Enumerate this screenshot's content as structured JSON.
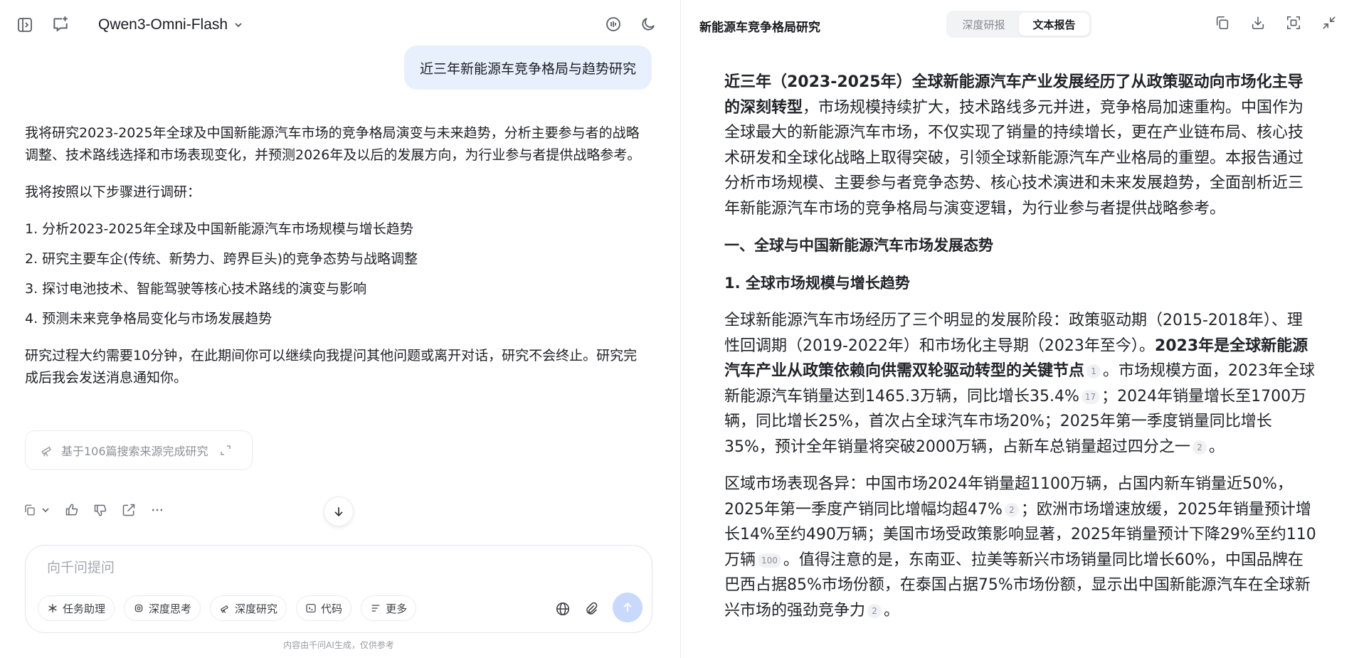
{
  "left": {
    "model_name": "Qwen3-Omni-Flash",
    "user_message": "近三年新能源车竞争格局与趋势研究",
    "answer": {
      "intro": "我将研究2023-2025年全球及中国新能源汽车市场的竞争格局演变与未来趋势，分析主要参与者的战略调整、技术路线选择和市场表现变化，并预测2026年及以后的发展方向，为行业参与者提供战略参考。",
      "steps_intro": "我将按照以下步骤进行调研：",
      "steps": [
        "1. 分析2023-2025年全球及中国新能源汽车市场规模与增长趋势",
        "2. 研究主要车企(传统、新势力、跨界巨头)的竞争态势与战略调整",
        "3. 探讨电池技术、智能驾驶等核心技术路线的演变与影响",
        "4. 预测未来竞争格局变化与市场发展趋势"
      ],
      "closing": "研究过程大约需要10分钟，在此期间你可以继续向我提问其他问题或离开对话，研究不会终止。研究完成后我会发送消息通知你。"
    },
    "source_card": "基于106篇搜索来源完成研究",
    "composer": {
      "placeholder": "向千问提问",
      "chips": [
        "任务助理",
        "深度思考",
        "深度研究",
        "代码",
        "更多"
      ]
    },
    "disclaimer": "内容由千问AI生成，仅供参考"
  },
  "right": {
    "title": "新能源车竞争格局研究",
    "tabs": [
      "深度研报",
      "文本报告"
    ],
    "active_tab": "文本报告",
    "report": {
      "p1_bold": "近三年（2023-2025年）全球新能源汽车产业发展经历了从政策驱动向市场化主导的深刻转型",
      "p1_rest": "，市场规模持续扩大，技术路线多元并进，竞争格局加速重构。中国作为全球最大的新能源汽车市场，不仅实现了销量的持续增长，更在产业链布局、核心技术研发和全球化战略上取得突破，引领全球新能源汽车产业格局的重塑。本报告通过分析市场规模、主要参与者竞争态势、核心技术演进和未来发展趋势，全面剖析近三年新能源汽车市场的竞争格局与演变逻辑，为行业参与者提供战略参考。",
      "h2": "一、全球与中国新能源汽车市场发展态势",
      "h3": "1. 全球市场规模与增长趋势",
      "p2_a": "全球新能源汽车市场经历了三个明显的发展阶段：政策驱动期（2015-2018年）、理性回调期（2019-2022年）和市场化主导期（2023年至今）。",
      "p2_bold": "2023年是全球新能源汽车产业从政策依赖向供需双轮驱动转型的关键节点",
      "cite1": "1",
      "p2_b": "。市场规模方面，2023年全球新能源汽车销量达到1465.3万辆，同比增长35.4%",
      "cite2": "17",
      "p2_c": "；2024年销量增长至1700万辆，同比增长25%，首次占全球汽车市场20%；2025年第一季度销量同比增长35%，预计全年销量将突破2000万辆，占新车总销量超过四分之一",
      "cite3": "2",
      "p2_d": "。",
      "p3_a": "区域市场表现各异：中国市场2024年销量超1100万辆，占国内新车销量近50%，2025年第一季度产销同比增幅均超47%",
      "cite4": "2",
      "p3_b": "；欧洲市场增速放缓，2025年销量预计增长14%至约490万辆；美国市场受政策影响显著，2025年销量预计下降29%至约110万辆",
      "cite5": "100",
      "p3_c": "。值得注意的是，东南亚、拉美等新兴市场销量同比增长60%，中国品牌在巴西占据85%市场份额，在泰国占据75%市场份额，显示出中国新能源汽车在全球新兴市场的强劲竞争力",
      "cite6": "2",
      "p3_d": "。"
    }
  }
}
